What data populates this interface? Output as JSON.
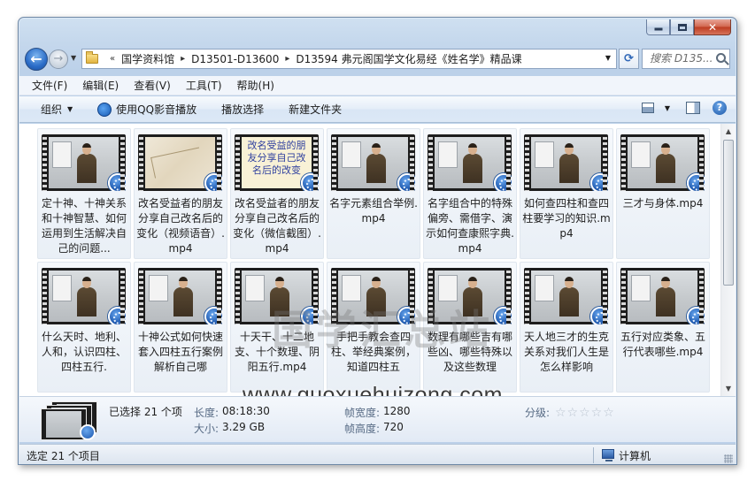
{
  "navigation": {
    "breadcrumbs": [
      "国学资料馆",
      "D13501-D13600",
      "D13594 弗元阁国学文化易经《姓名学》精品课"
    ],
    "search_placeholder": "搜索 D135..."
  },
  "menubar": {
    "items": [
      "文件(F)",
      "编辑(E)",
      "查看(V)",
      "工具(T)",
      "帮助(H)"
    ]
  },
  "toolbar": {
    "organize": "组织",
    "play_qq": "使用QQ影音播放",
    "play_selection": "播放选择",
    "new_folder": "新建文件夹"
  },
  "files": [
    {
      "label": "定十神、十神关系和十神智慧、如何运用到生活解决自己的问题...",
      "thumb": "teacher"
    },
    {
      "label": "改名受益者的朋友分享自己改名后的变化（视频语音）.mp4",
      "thumb": "map"
    },
    {
      "label": "改名受益者的朋友分享自己改名后的变化（微信截图）.mp4",
      "thumb": "text",
      "thumb_text": "改名受益的朋友分享自己改名后的改变"
    },
    {
      "label": "名字元素组合举例.mp4",
      "thumb": "teacher"
    },
    {
      "label": "名字组合中的特殊偏旁、需借字、演示如何查康熙字典.mp4",
      "thumb": "teacher"
    },
    {
      "label": "如何查四柱和查四柱要学习的知识.mp4",
      "thumb": "teacher"
    },
    {
      "label": "三才与身体.mp4",
      "thumb": "teacher"
    },
    {
      "label": "什么天时、地利、人和，认识四柱、四柱五行.",
      "thumb": "teacher"
    },
    {
      "label": "十神公式如何快速套入四柱五行案例解析自己哪",
      "thumb": "teacher"
    },
    {
      "label": "十天干、十二地支、十个数理、阴阳五行.mp4",
      "thumb": "teacher"
    },
    {
      "label": "手把手教会查四柱、举经典案例，知道四柱五",
      "thumb": "teacher"
    },
    {
      "label": "数理有哪些吉有哪些凶、哪些特殊以及这些数理",
      "thumb": "teacher"
    },
    {
      "label": "天人地三才的生克关系对我们人生是怎么样影响",
      "thumb": "teacher"
    },
    {
      "label": "五行对应类象、五行代表哪些.mp4",
      "thumb": "teacher"
    }
  ],
  "watermark": {
    "chinese": "国学汇总站",
    "url": "www.guoxuehuizong.com"
  },
  "details": {
    "selected": "已选择 21 个项",
    "duration_key": "长度:",
    "duration_val": "08:18:30",
    "size_key": "大小:",
    "size_val": "3.29 GB",
    "width_key": "帧宽度:",
    "width_val": "1280",
    "height_key": "帧高度:",
    "height_val": "720",
    "rating_key": "分级:",
    "rating_stars": 0
  },
  "status": {
    "left": "选定 21 个项目",
    "right": "计算机"
  }
}
